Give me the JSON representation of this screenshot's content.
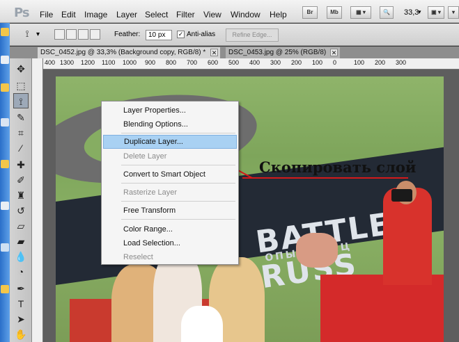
{
  "app": {
    "logo": "Ps"
  },
  "menu": [
    "File",
    "Edit",
    "Image",
    "Layer",
    "Select",
    "Filter",
    "View",
    "Window",
    "Help"
  ],
  "menubar_buttons": [
    "Br",
    "Mb"
  ],
  "zoom": "33,3",
  "options": {
    "feather_label": "Feather:",
    "feather_value": "10 px",
    "antialias_label": "Anti-alias",
    "antialias_checked": true,
    "refine_edge": "Refine Edge..."
  },
  "tabs": [
    {
      "label": "DSC_0452.jpg @ 33,3% (Background copy, RGB/8) *",
      "active": true
    },
    {
      "label": "DSC_0453.jpg @ 25% (RGB/8)",
      "active": false
    }
  ],
  "ruler": [
    "400",
    "1300",
    "1200",
    "1100",
    "1000",
    "900",
    "800",
    "700",
    "600",
    "500",
    "400",
    "300",
    "200",
    "100",
    "0",
    "100",
    "200",
    "300"
  ],
  "context_menu": [
    {
      "label": "Layer Properties...",
      "enabled": true,
      "highlighted": false
    },
    {
      "label": "Blending Options...",
      "enabled": true,
      "highlighted": false
    },
    {
      "label": "Duplicate Layer...",
      "enabled": true,
      "highlighted": true
    },
    {
      "label": "Delete Layer",
      "enabled": false,
      "highlighted": false
    },
    {
      "label": "Convert to Smart Object",
      "enabled": true,
      "highlighted": false
    },
    {
      "label": "Rasterize Layer",
      "enabled": false,
      "highlighted": false
    },
    {
      "label": "Free Transform",
      "enabled": true,
      "highlighted": false
    },
    {
      "label": "Color Range...",
      "enabled": true,
      "highlighted": false
    },
    {
      "label": "Load Selection...",
      "enabled": true,
      "highlighted": false
    },
    {
      "label": "Reselect",
      "enabled": false,
      "highlighted": false
    }
  ],
  "annotation": {
    "text": "Скопировать слой",
    "color": "#d41a1a"
  },
  "photo": {
    "banner_text": "BATTLE RUSS",
    "banner_sub": "ОПЫ СТАНЦ"
  },
  "tools": [
    "move-tool",
    "marquee-tool",
    "lasso-tool",
    "quick-select-tool",
    "crop-tool",
    "eyedropper-tool",
    "healing-brush-tool",
    "brush-tool",
    "clone-stamp-tool",
    "history-brush-tool",
    "eraser-tool",
    "gradient-tool",
    "blur-tool",
    "dodge-tool",
    "pen-tool",
    "type-tool",
    "path-select-tool",
    "shape-tool",
    "hand-tool"
  ]
}
